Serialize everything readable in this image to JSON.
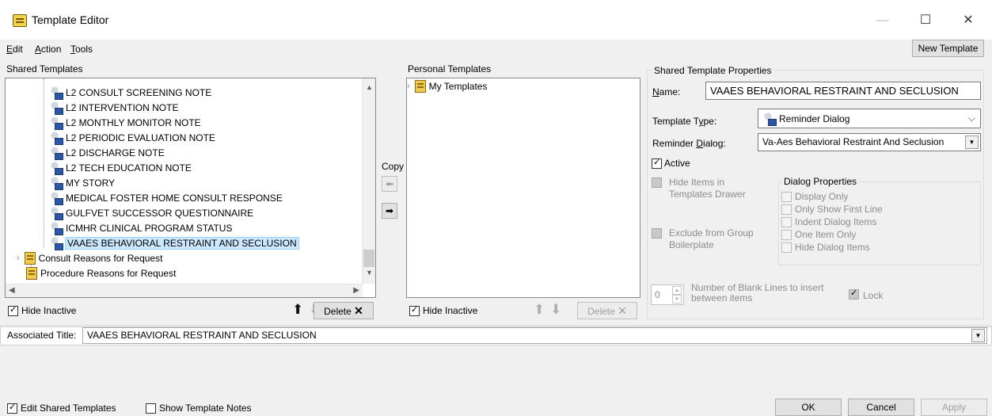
{
  "window": {
    "title": "Template Editor",
    "min_icon": "—",
    "max_icon": "☐",
    "close_icon": "✕"
  },
  "menu": {
    "edit": "Edit",
    "action": "Action",
    "tools": "Tools",
    "new_template": "New Template"
  },
  "shared": {
    "label": "Shared Templates",
    "items": [
      {
        "label": "L2 CONSULT SCREENING NOTE",
        "icon": "reminder-dialog-icon"
      },
      {
        "label": "L2 INTERVENTION NOTE",
        "icon": "reminder-dialog-icon"
      },
      {
        "label": "L2 MONTHLY MONITOR NOTE",
        "icon": "reminder-dialog-icon"
      },
      {
        "label": "L2 PERIODIC EVALUATION NOTE",
        "icon": "reminder-dialog-icon"
      },
      {
        "label": "L2 DISCHARGE NOTE",
        "icon": "reminder-dialog-icon"
      },
      {
        "label": "L2 TECH EDUCATION NOTE",
        "icon": "reminder-dialog-icon"
      },
      {
        "label": "MY STORY",
        "icon": "reminder-dialog-icon"
      },
      {
        "label": "MEDICAL FOSTER HOME CONSULT RESPONSE",
        "icon": "reminder-dialog-icon"
      },
      {
        "label": "GULFVET SUCCESSOR QUESTIONNAIRE",
        "icon": "reminder-dialog-icon"
      },
      {
        "label": "ICMHR CLINICAL PROGRAM STATUS",
        "icon": "reminder-dialog-icon"
      },
      {
        "label": "VAAES BEHAVIORAL RESTRAINT AND SECLUSION",
        "icon": "reminder-dialog-icon",
        "selected": true
      },
      {
        "label": "Consult Reasons for Request",
        "icon": "folder-icon"
      },
      {
        "label": "Procedure Reasons for Request",
        "icon": "folder-icon"
      }
    ],
    "hide_inactive": "Hide Inactive",
    "delete": "Delete"
  },
  "copy": {
    "label": "Copy"
  },
  "personal": {
    "label": "Personal Templates",
    "items": [
      {
        "label": "My Templates",
        "icon": "folder-icon"
      }
    ],
    "hide_inactive": "Hide Inactive",
    "delete": "Delete"
  },
  "props": {
    "group_title": "Shared Template Properties",
    "name_label": "Name:",
    "name_value": "VAAES BEHAVIORAL RESTRAINT AND SECLUSION",
    "type_label": "Template Type:",
    "type_value": "Reminder Dialog",
    "dialog_label": "Reminder Dialog:",
    "dialog_value": "Va-Aes Behavioral Restraint And Seclusion",
    "active": "Active",
    "hide_items": "Hide Items in Templates Drawer",
    "exclude": "Exclude from Group Boilerplate",
    "dialog_props_title": "Dialog Properties",
    "dialog_props": [
      "Display Only",
      "Only Show First Line",
      "Indent Dialog Items",
      "One Item Only",
      "Hide Dialog Items"
    ],
    "blank_lines_value": "0",
    "blank_lines_label": "Number of Blank Lines to insert between items",
    "lock": "Lock"
  },
  "associated": {
    "label": "Associated Title:",
    "value": "VAAES BEHAVIORAL RESTRAINT AND SECLUSION"
  },
  "footer": {
    "edit_shared": "Edit Shared Templates",
    "show_notes": "Show Template Notes",
    "ok": "OK",
    "cancel": "Cancel",
    "apply": "Apply"
  }
}
